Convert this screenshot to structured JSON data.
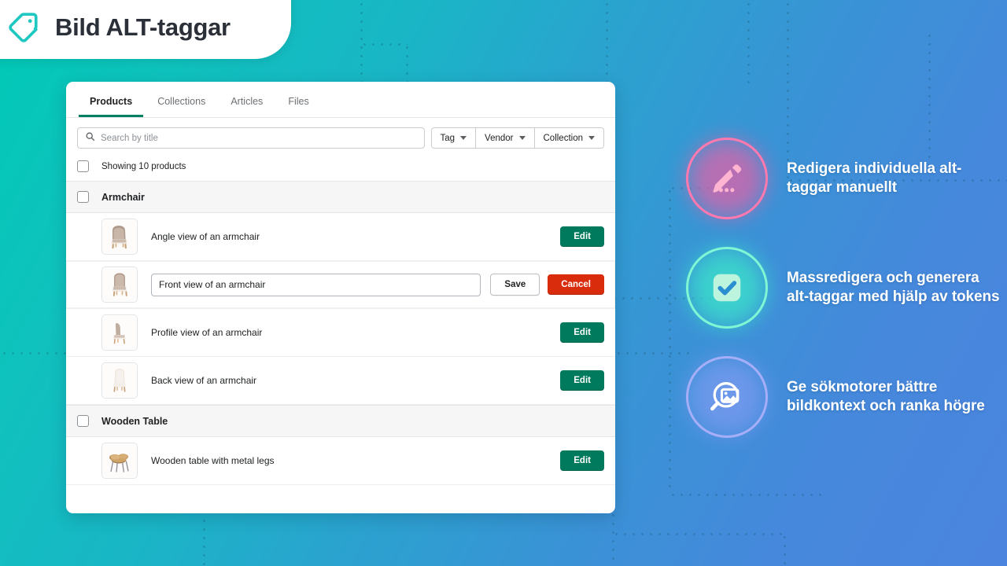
{
  "header": {
    "title": "Bild ALT-taggar",
    "icon": "tag-icon"
  },
  "card": {
    "tabs": [
      {
        "label": "Products",
        "active": true
      },
      {
        "label": "Collections",
        "active": false
      },
      {
        "label": "Articles",
        "active": false
      },
      {
        "label": "Files",
        "active": false
      }
    ],
    "search": {
      "placeholder": "Search by title",
      "value": "",
      "icon": "search-icon"
    },
    "filters": [
      {
        "label": "Tag"
      },
      {
        "label": "Vendor"
      },
      {
        "label": "Collection"
      }
    ],
    "showing_text": "Showing 10 products",
    "groups": [
      {
        "title": "Armchair",
        "rows": [
          {
            "alt": "Angle view of an armchair",
            "editing": false,
            "thumb": "armchair-angle",
            "button": "Edit"
          },
          {
            "alt": "Front view of an armchair",
            "editing": true,
            "thumb": "armchair-front",
            "save": "Save",
            "cancel": "Cancel"
          },
          {
            "alt": "Profile view of an armchair",
            "editing": false,
            "thumb": "armchair-profile",
            "button": "Edit"
          },
          {
            "alt": "Back view of an armchair",
            "editing": false,
            "thumb": "armchair-back",
            "button": "Edit"
          }
        ]
      },
      {
        "title": "Wooden Table",
        "rows": [
          {
            "alt": "Wooden table with metal legs",
            "editing": false,
            "thumb": "wooden-table",
            "button": "Edit"
          }
        ]
      }
    ]
  },
  "features": [
    {
      "text": "Redigera individuella alt-taggar manuellt",
      "icon": "pencil-edit-icon",
      "color": "#ff79ae"
    },
    {
      "text": "Massredigera och generera alt-taggar med hjälp av tokens",
      "icon": "checkbox-checked-icon",
      "color": "#7ff7d4"
    },
    {
      "text": "Ge sökmotorer bättre bildkontext och ranka högre",
      "icon": "search-image-icon",
      "color": "#a7aef8"
    }
  ],
  "colors": {
    "background_start": "#00c9b7",
    "background_end": "#4b84de",
    "accent_green": "#007a5c",
    "accent_red": "#d82c0d",
    "brand_teal": "#1ec8c0"
  }
}
